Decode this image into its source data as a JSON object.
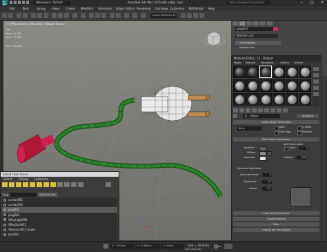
{
  "titlebar": {
    "workspace": "Workspace: Default",
    "title": "Autodesk 3ds Max 2015 x64    vilka1.max",
    "search_placeholder": "Type a keyword or phrase"
  },
  "menu": [
    "Edit",
    "Tools",
    "Group",
    "Views",
    "Create",
    "Modifiers",
    "Animation",
    "Graph Editors",
    "Rendering",
    "Civil View",
    "Customize",
    "MAXScript",
    "Help"
  ],
  "toolbar": {
    "selection_set": "Create Selection Se"
  },
  "viewport": {
    "label": "[+] [Perspective ] [Shaded + Edged Faces ]",
    "stats": {
      "total_label": "Total",
      "polys": "Polys:   22 920",
      "verts": "Verts:   11 620",
      "fps": "FPS:    115,606"
    }
  },
  "command_panel": {
    "object_name": "plug001",
    "modifier_list": "Modifier List",
    "stack": [
      "TurboSmooth",
      "Editable Poly"
    ]
  },
  "material_editor": {
    "title": "Material Editor - 11 - Default",
    "menu": [
      "Modes",
      "Material",
      "Navigation",
      "Options",
      "Utilities"
    ],
    "material_name": "11 - Default",
    "material_type": "Standard",
    "rollouts": {
      "shader": "Shader Basic Parameters",
      "blinn": "Blinn Basic Parameters",
      "extended": "Extended Parameters",
      "supersampling": "SuperSampling",
      "maps": "Maps",
      "mental_ray": "mental ray Connection"
    },
    "shader_type": "Blinn",
    "checks": {
      "wire": "Wire",
      "two_sided": "2-Sided",
      "face_map": "Face Map",
      "faceted": "Faceted"
    },
    "self_illum": "Self-Illumination",
    "color_label": "Color",
    "color_value": "0",
    "ambient": "Ambient:",
    "diffuse": "Diffuse:",
    "specular": "Specular:",
    "opacity_label": "Opacity:",
    "opacity_value": "100",
    "spec_highlights": "Specular Highlights",
    "spec_level_label": "Specular Level:",
    "spec_level": "0",
    "glossiness_label": "Glossiness:",
    "glossiness": "10",
    "soften_label": "Soften:",
    "soften": "0,1",
    "colors": {
      "ambient": "#606060",
      "diffuse": "#8a8a8a",
      "specular": "#e6e6e6"
    }
  },
  "select_from_scene": {
    "title": "Select From Scene",
    "menu": [
      "Select",
      "Display",
      "Customize"
    ],
    "find_label": "Find:",
    "selection_set": "Selection Set:",
    "items": [
      "cordac001",
      "cordac002",
      "plug001",
      "plug002",
      "VRayLight001",
      "VRaySun001",
      "VRaySun001.Target",
      "wire001"
    ]
  },
  "statusbar": {
    "x": "X: 7,478cm",
    "y": "Y: -47,896cm",
    "z": "Z: 0,0cm",
    "grid": "Grid = 10,0mm",
    "add_time_tag": "Add Time Tag"
  }
}
